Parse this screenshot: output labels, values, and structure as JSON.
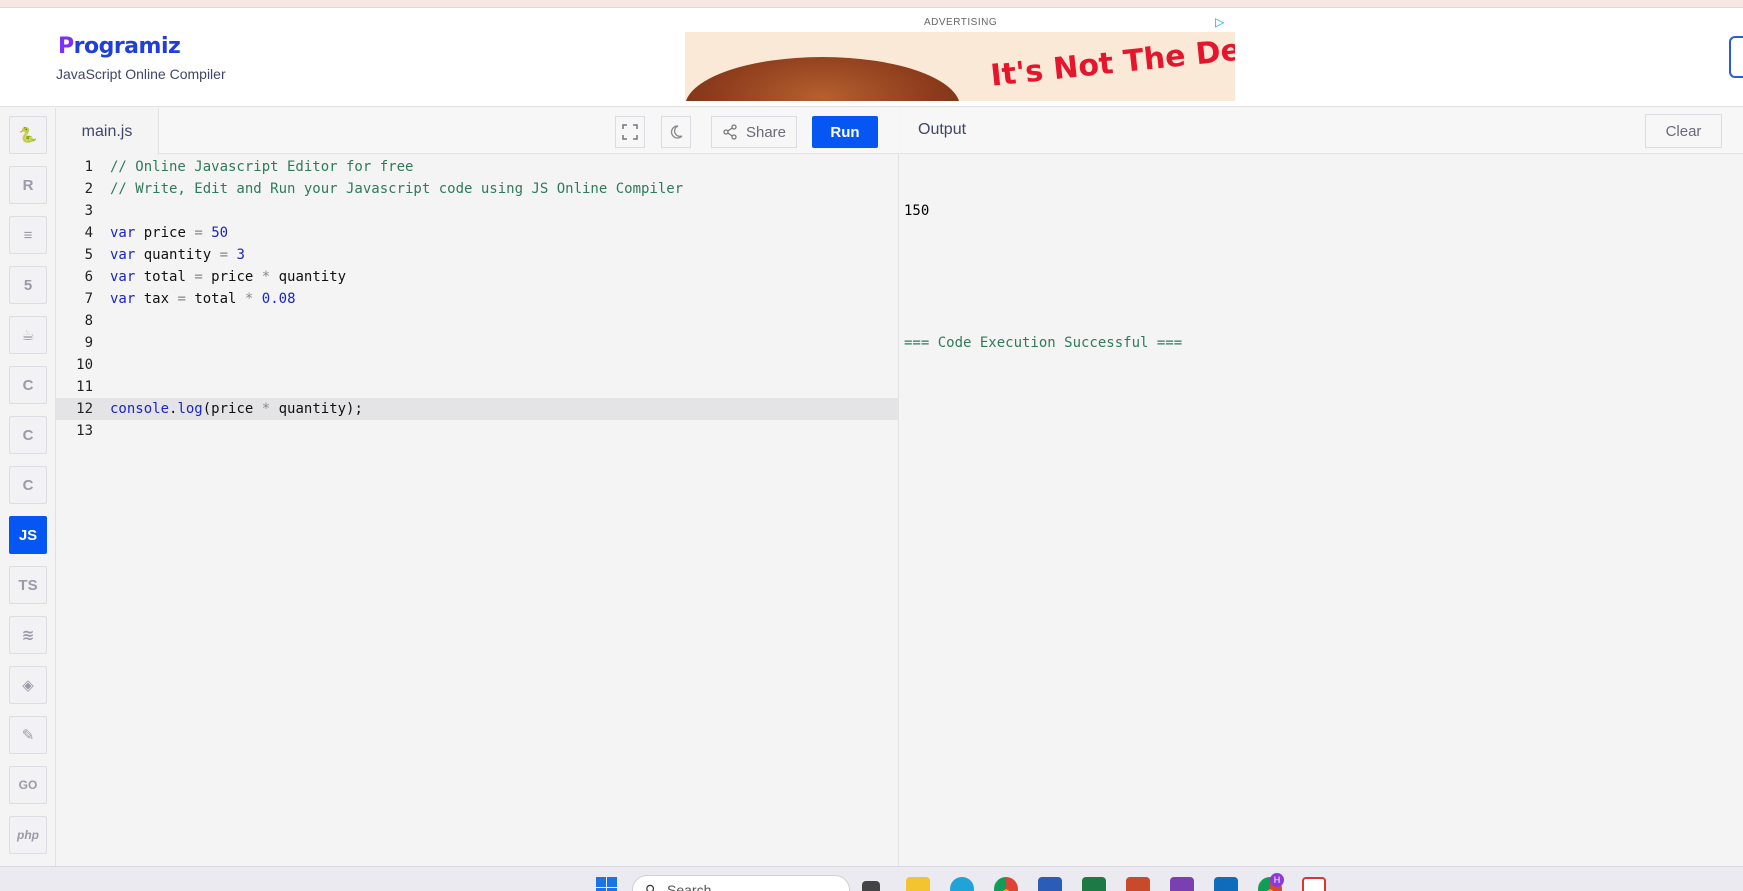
{
  "brand": {
    "logo_p": "P",
    "logo_rest": "rogramiz",
    "subtitle": "JavaScript Online Compiler"
  },
  "ad": {
    "label": "ADVERTISING",
    "headline": "It's Not The Deli,"
  },
  "sidebar": {
    "items": [
      {
        "name": "python",
        "glyph": "🐍"
      },
      {
        "name": "r",
        "glyph": "R"
      },
      {
        "name": "sql",
        "glyph": "≡"
      },
      {
        "name": "html",
        "glyph": "5"
      },
      {
        "name": "java",
        "glyph": "☕"
      },
      {
        "name": "c",
        "glyph": "C"
      },
      {
        "name": "cpp",
        "glyph": "C"
      },
      {
        "name": "csharp",
        "glyph": "C"
      },
      {
        "name": "javascript",
        "glyph": "JS"
      },
      {
        "name": "typescript",
        "glyph": "TS"
      },
      {
        "name": "scala",
        "glyph": "≋"
      },
      {
        "name": "swift",
        "glyph": "◈"
      },
      {
        "name": "rust",
        "glyph": "✎"
      },
      {
        "name": "go",
        "glyph": "GO"
      },
      {
        "name": "php",
        "glyph": "php"
      }
    ],
    "active": "javascript"
  },
  "editor": {
    "tab_label": "main.js",
    "share_label": "Share",
    "run_label": "Run",
    "lines": [
      {
        "n": "1",
        "text": "// Online Javascript Editor for free"
      },
      {
        "n": "2",
        "text": "// Write, Edit and Run your Javascript code using JS Online Compiler"
      },
      {
        "n": "3",
        "text": ""
      },
      {
        "n": "4",
        "text": "var price = 50"
      },
      {
        "n": "5",
        "text": "var quantity = 3"
      },
      {
        "n": "6",
        "text": "var total = price * quantity"
      },
      {
        "n": "7",
        "text": "var tax = total * 0.08"
      },
      {
        "n": "8",
        "text": ""
      },
      {
        "n": "9",
        "text": ""
      },
      {
        "n": "10",
        "text": ""
      },
      {
        "n": "11",
        "text": ""
      },
      {
        "n": "12",
        "text": "console.log(price * quantity);"
      },
      {
        "n": "13",
        "text": ""
      }
    ],
    "active_line": "12"
  },
  "output": {
    "title": "Output",
    "clear_label": "Clear",
    "result": "150",
    "status": "=== Code Execution Successful ==="
  },
  "taskbar": {
    "search_placeholder": "Search",
    "badge": "H"
  }
}
